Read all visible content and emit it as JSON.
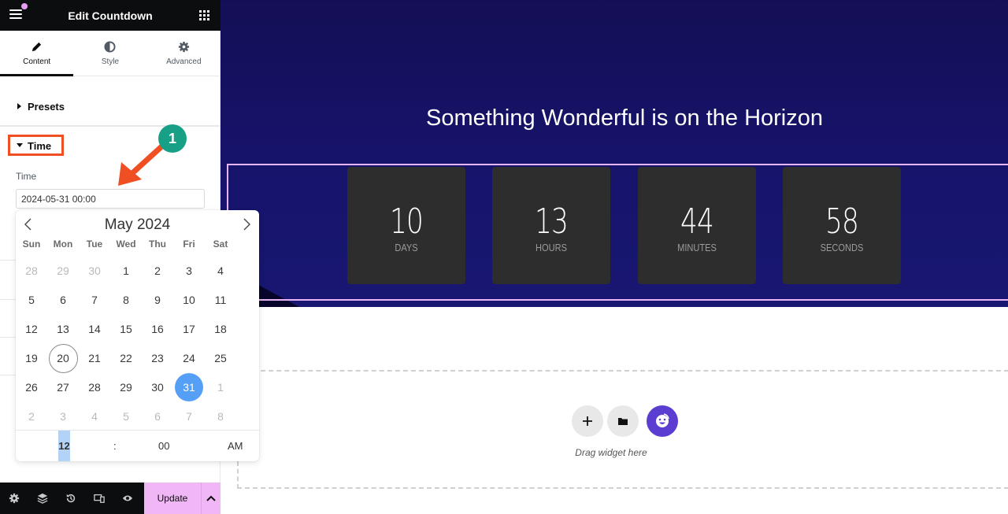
{
  "panel": {
    "title": "Edit Countdown",
    "tabs": [
      {
        "label": "Content",
        "icon": "pencil-icon",
        "active": true
      },
      {
        "label": "Style",
        "icon": "half-circle-icon",
        "active": false
      },
      {
        "label": "Advanced",
        "icon": "gear-icon",
        "active": false
      }
    ],
    "sections": {
      "presets": "Presets",
      "time": "Time"
    },
    "time_field": {
      "label": "Time",
      "value": "2024-05-31 00:00"
    },
    "footer": {
      "icons": [
        "gear-icon",
        "layers-icon",
        "history-icon",
        "responsive-icon",
        "eye-icon"
      ],
      "update_label": "Update"
    }
  },
  "annotation": {
    "step": "1",
    "color": "#f04e23",
    "badge_color": "#17a085"
  },
  "calendar": {
    "month_label": "May 2024",
    "weekdays": [
      "Sun",
      "Mon",
      "Tue",
      "Wed",
      "Thu",
      "Fri",
      "Sat"
    ],
    "days": [
      {
        "d": "28",
        "muted": true
      },
      {
        "d": "29",
        "muted": true
      },
      {
        "d": "30",
        "muted": true
      },
      {
        "d": "1"
      },
      {
        "d": "2"
      },
      {
        "d": "3"
      },
      {
        "d": "4"
      },
      {
        "d": "5"
      },
      {
        "d": "6"
      },
      {
        "d": "7"
      },
      {
        "d": "8"
      },
      {
        "d": "9"
      },
      {
        "d": "10"
      },
      {
        "d": "11"
      },
      {
        "d": "12"
      },
      {
        "d": "13"
      },
      {
        "d": "14"
      },
      {
        "d": "15"
      },
      {
        "d": "16"
      },
      {
        "d": "17"
      },
      {
        "d": "18"
      },
      {
        "d": "19"
      },
      {
        "d": "20",
        "today": true
      },
      {
        "d": "21"
      },
      {
        "d": "22"
      },
      {
        "d": "23"
      },
      {
        "d": "24"
      },
      {
        "d": "25"
      },
      {
        "d": "26"
      },
      {
        "d": "27"
      },
      {
        "d": "28"
      },
      {
        "d": "29"
      },
      {
        "d": "30"
      },
      {
        "d": "31",
        "selected": true
      },
      {
        "d": "1",
        "muted": true
      },
      {
        "d": "2",
        "muted": true
      },
      {
        "d": "3",
        "muted": true
      },
      {
        "d": "4",
        "muted": true
      },
      {
        "d": "5",
        "muted": true
      },
      {
        "d": "6",
        "muted": true
      },
      {
        "d": "7",
        "muted": true
      },
      {
        "d": "8",
        "muted": true
      }
    ],
    "time": {
      "hour": "12",
      "separator": ":",
      "minute": "00",
      "ampm": "AM"
    },
    "selected_color": "#569ff7"
  },
  "canvas": {
    "hero_title": "Something Wonderful is on the Horizon",
    "countdown": [
      {
        "value": "10",
        "label": "DAYS"
      },
      {
        "value": "13",
        "label": "HOURS"
      },
      {
        "value": "44",
        "label": "MINUTES"
      },
      {
        "value": "58",
        "label": "SECONDS"
      }
    ],
    "dropzone": {
      "text": "Drag widget here",
      "buttons": [
        "plus-icon",
        "folder-icon",
        "ai-assistant-icon"
      ]
    }
  }
}
